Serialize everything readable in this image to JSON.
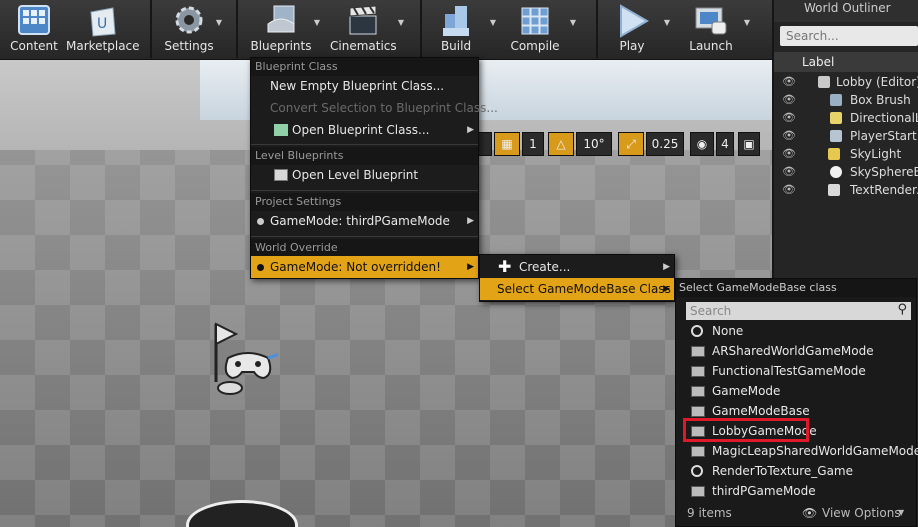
{
  "toolbar": {
    "items": [
      "Content",
      "Marketplace",
      "Settings",
      "Blueprints",
      "Cinematics",
      "Build",
      "Compile",
      "Play",
      "Launch"
    ]
  },
  "viewport_tools": {
    "snap_count": "1",
    "rotation_snap": "10°",
    "scale_snap": "0.25",
    "camera_speed": "4"
  },
  "outliner": {
    "title": "World Outliner",
    "search_placeholder": "Search...",
    "column": "Label",
    "rows": [
      "Lobby (Editor)",
      "Box Brush",
      "DirectionalLig",
      "PlayerStart",
      "SkyLight",
      "SkySphereBlu",
      "TextRenderA"
    ]
  },
  "blueprints_menu": {
    "section1": "Blueprint Class",
    "new_empty": "New Empty Blueprint Class...",
    "convert": "Convert Selection to Blueprint Class...",
    "open_class": "Open Blueprint Class...",
    "section2": "Level Blueprints",
    "open_level": "Open Level Blueprint",
    "section3": "Project Settings",
    "project_gm": "GameMode: thirdPGameMode",
    "section4": "World Override",
    "world_gm": "GameMode: Not overridden!"
  },
  "submenu": {
    "create": "Create...",
    "select_base": "Select GameModeBase Class"
  },
  "picker": {
    "title": "Select GameModeBase class",
    "search_placeholder": "Search",
    "items": [
      "None",
      "ARSharedWorldGameMode",
      "FunctionalTestGameMode",
      "GameMode",
      "GameModeBase",
      "LobbyGameMode",
      "MagicLeapSharedWorldGameMode",
      "RenderToTexture_Game",
      "thirdPGameMode"
    ],
    "count": "9 items",
    "view_options": "View Options"
  },
  "colors": {
    "accent": "#e3a317",
    "highlight_box": "#e0192a"
  }
}
